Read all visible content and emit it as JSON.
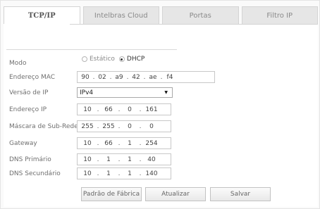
{
  "tabs": [
    {
      "label": "TCP/IP",
      "active": true
    },
    {
      "label": "Intelbras Cloud",
      "active": false
    },
    {
      "label": "Portas",
      "active": false
    },
    {
      "label": "Filtro IP",
      "active": false
    }
  ],
  "form": {
    "modo": {
      "label": "Modo",
      "options": [
        "Estático",
        "DHCP"
      ],
      "selected": "DHCP"
    },
    "mac": {
      "label": "Endereço MAC",
      "octets": [
        "90",
        "02",
        "a9",
        "42",
        "ae",
        "f4"
      ]
    },
    "ip_version": {
      "label": "Versão de IP",
      "value": "IPv4"
    },
    "ip": {
      "label": "Endereço IP",
      "octets": [
        "10",
        "66",
        "0",
        "161"
      ]
    },
    "mask": {
      "label": "Máscara de Sub-Rede",
      "octets": [
        "255",
        "255",
        "0",
        "0"
      ]
    },
    "gateway": {
      "label": "Gateway",
      "octets": [
        "10",
        "66",
        "1",
        "254"
      ]
    },
    "dns1": {
      "label": "DNS Primário",
      "octets": [
        "10",
        "1",
        "1",
        "40"
      ]
    },
    "dns2": {
      "label": "DNS Secundário",
      "octets": [
        "10",
        "1",
        "1",
        "140"
      ]
    }
  },
  "buttons": {
    "factory": "Padrão de Fábrica",
    "refresh": "Atualizar",
    "save": "Salvar"
  },
  "separator": "."
}
